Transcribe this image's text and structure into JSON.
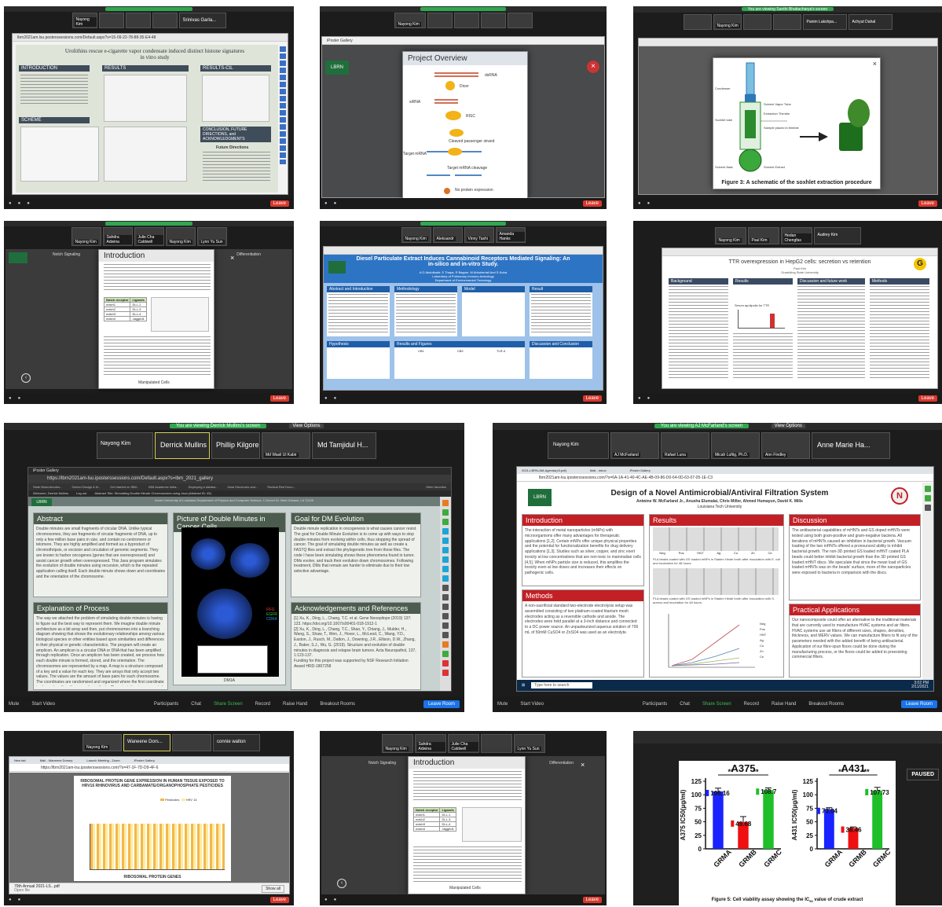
{
  "tiles": {
    "t1": {
      "participants": [
        "Nayong Kim",
        "Srinivas Garla..."
      ],
      "url": "lbrn2021am.lsu.posterssessions.com/Default.aspx?s=15-09-22-78-88-35-E4-48",
      "poster_title": "Urolithins rescue e-cigarette vapor condensate induced distinct histone signatures in vitro study",
      "sections": [
        "INTRODUCTION",
        "RESULTS",
        "RESULTS-CtL",
        "SCHEME",
        "CONCLUSION, FUTURE DIRECTIONS, and ACKNOWLEDGMENTS"
      ],
      "sub": "Future Directions"
    },
    "t2": {
      "participants": [
        "Nayong Kim"
      ],
      "tab": "iPoster Gallery",
      "modal_title": "Project Overview",
      "labels": [
        "dsRNA",
        "Dicer",
        "siRNA",
        "RISC",
        "Cleaved passenger strand",
        "Target mRNA",
        "Target mRNA cleavage",
        "No protein expression"
      ],
      "badge": "LBRN"
    },
    "t3": {
      "banner": "You are viewing Santhi Bhattacharya's screen",
      "participants": [
        "Nayong Kim",
        "Panim Lakshpa...",
        "Achyut Dahal"
      ],
      "caption": "Figure 3: A schematic of the soxhlet extraction procedure",
      "labels": [
        "Condenser",
        "Soxhlet tube",
        "Solvent flask",
        "Solvent Vapor Tube",
        "Extraction Thimble",
        "Sample placed in thimble",
        "Solvent Extract"
      ]
    },
    "t4": {
      "participants": [
        "Nayong Kim",
        "Sahdra Adwina",
        "Julie Cha Caldwell",
        "Nayong Kim",
        "Lynn Yu Sun"
      ],
      "modal_title": "Introduction",
      "left_label": "Notch Signaling",
      "right_label": "Differentiation",
      "table_headers": [
        "Notch receptor",
        "Ligands"
      ],
      "table_rows": [
        [
          "notch1",
          "DLL-1"
        ],
        [
          "notch2",
          "DLL-3"
        ],
        [
          "notch3",
          "DLL-4"
        ],
        [
          "notch4",
          "Jagged1"
        ],
        [
          "",
          "Jagged2"
        ]
      ],
      "bottom_label": "Manipulated Cells"
    },
    "t5": {
      "participants": [
        "Nayong Kim",
        "Aleksandr",
        "Vinny Tashi",
        "Amanda Hanks"
      ],
      "poster_title": "Diesel Particulate Extract Induces Cannabinoid Receptors Mediated Signaling: An in-silico and in-vitro Study.",
      "authors": "A G Abdulkadir, S Thapa, R Bagum, M Abbulmrtali And S Kutra",
      "lab": "Laboratory of Pulmonary Immuno-toxicology",
      "dept": "Department of Environmental Toxicology",
      "sections": [
        "Abstract and Introduction",
        "Methodology",
        "Model",
        "Result",
        "Hypothesis",
        "Results and Figures",
        "Discussion and Conclusion"
      ],
      "chart_labels": [
        "CB1",
        "CB2",
        "TLR-4"
      ]
    },
    "t6": {
      "participants": [
        "Nayong Kim",
        "Paul Kim",
        "Hedan Chengfas",
        "Audrey Kim"
      ],
      "poster_title": "TTR overexpression in HepG2 cells: secretion vs retention",
      "author": "Paul Kim",
      "school": "Grambling State University",
      "sections": [
        "Background",
        "Results",
        "Discussion and future work",
        "Methods"
      ],
      "chart_title": "Serum apolipolis for TTR"
    },
    "t7": {
      "banner": "You are viewing Derrick Mullins's screen",
      "view_options": "View Options",
      "participants": [
        "Nayong Kim",
        "Derrick Mullins",
        "Phillip Kilgore",
        "Md Wasil Ul Kabir",
        "Md Tamjidul H..."
      ],
      "tab": "iPoster Gallery",
      "url": "https://lbrn2021am-lsu.iposterssessions.com/Default.aspx?s=lbrn_2021_gallery",
      "bookmarks": [
        "Slate Biomolecules...",
        "Solved Design A M...",
        "Get started on IBM...",
        "IBM Academic Initia...",
        "Deploying a databa...",
        "Data Structures and...",
        "Radical Red Docu...",
        "Other favorites"
      ],
      "welcome": "Welcome, Derrick Mullins",
      "logout": "Log out",
      "abstract_title": "Abstract Title: Simulating Double Minute Chromosomes using Java (Abstract ID: 45)",
      "poster_header": "Xavier University of Louisiana Department of Physics and Computer Science, 1 Drexel Dr. New Orleans, LA 70125",
      "logo": "LBRN",
      "sections": {
        "abstract": "Abstract",
        "pic": "Picture of Double Minutes in Cancer Cells",
        "goal": "Goal for DM Evolution",
        "explain": "Explanation of Process",
        "ack": "Acknowledgements and References"
      },
      "abstract_text": "Double minutes are small fragments of circular DNA. Unlike typical chromosomes, they are fragments of circular fragments of DNA, up to only a few million base pairs in size, and contain no centromere or telomere. They are highly amplified and formed as a byproduct of chromothripsis, or excision and circulation of genomic segments. They are known to harbor oncogenes (genes that are overexpressed) and assist cancer growth when overexpressed. This Java program simulates the evolution of double minutes using recursion, which is the repeated application calling itself. Each double minute shows down and coordinates and the orientation of the chromosome.",
      "goal_text": "Double minute replication in oncogenesis is what causes cancer resist. The goal for Double Minute Evolution is to come up with ways to stop double minutes from evolving within cells, thus stopping the spread of cancer. The goal of simulating double minutes as well as create a FASTQ files and extract the phylogenetic tree from those files. The code I have been simulating shows these phenomena found in tumor. DMs evolve, and track their evolution down chromosomes. Following treatment, DMs that remain are harder to eliminate due to their low selective advantage.",
      "explain_text": "The way we attached the problem of simulating double minutes is having to figure out the best way to represent them. We imagine double minute architecture as a bit array and then, put chromosomes into a branching diagram showing that shows the evolutionary relationships among various biological species or other entities based upon similarities and differences in their physical or genetic characteristics. The program will create an amplicon. An amplicon is a circular DNA or DNA that has been amplified through replication. Once an amplicon has been created, we process how each double minute is formed, stored, and the orientation. The chromosomes are represented by a map. A map is a structure composed of a key and a value for each key. They are arrays that only accept two values. The values are the amount of base pairs for each chromosome. The coordinates are randomized and organized where the first coordinate is always less than the second coordinate. The orientation is represented by a positive or negative. There are equally recursive calls for it to replicate on its own. We start from a parent amplicon and then the recursive calls will replicate them by 2 each level.",
      "ack_text": "[1] Xu, K., Ding, L., Chang, T.C. et al. Gene Neoepitope (2019) 137: 123. https://doi.org/10.1007/s00401-018-1912-1\n[2] Xu, K., Ding, L., Chang, T.C., Shao, Y., Chiang, J., Mulder, H., Wang, S., Shaw, T., Wen, J., Hover, L., McLeod, C., Wang, Y.D., Easton, J., Rusch, M., Dalton, J., Downing, J.R., Ellison, D.W., Zhang, J., Baker, S.J., Wu, G. (2019). Structure and evolution of double minutes in diagnosis and relapse brain tumors. Acta Neuropathol, 137, 1:123-137.\nFunding for this project was supported by NSF Research Initiation Award HRD-1807258",
      "legend": [
        "RFG",
        "EGFR",
        "CDK4"
      ],
      "bottom_caption": "DM1A",
      "toolbar": [
        "Mute",
        "Start Video",
        "Participants",
        "Chat",
        "Share Screen",
        "Record",
        "Raise Hand",
        "Breakout Rooms"
      ],
      "leave": "Leave Room"
    },
    "t8": {
      "banner": "You are viewing AJ McFarland's screen",
      "view_options": "View Options",
      "participants": [
        "Nayong Kim",
        "AJ McFarland",
        "Rafael Luna",
        "Micah Luftig, Ph.D.",
        "Ann Findley",
        "Anne Marie Ha..."
      ],
      "tabs": [
        "2021-LBRN-AM-Agenda(v3.pdf)",
        "Mail - Inbox",
        "iPoster Gallery"
      ],
      "url": "lbrn2021am-lsu.iposterssessions.com/?s=6A-1A-41-40-4C-AE-4B-09-86-D0-64-0D-63-07-05-1E-C3",
      "poster_title": "Design of a Novel Antimicrobial/Antiviral Filtration System",
      "authors": "Antwine W. McFarland Jr., Anusha Elumalai, Chris Miller, Ahmed Humayun, David K. Mills",
      "school": "Louisiana Tech University",
      "logo": "LBRN",
      "sections": {
        "intro": "Introduction",
        "results": "Results",
        "discussion": "Discussion",
        "methods": "Methods",
        "practical": "Practical Applications"
      },
      "intro_text": "The interaction of metal nanoparticles (mNPs) with microorganisms offer many advantages for therapeutic applications [1,2]. Certain mNPs offer unique physical properties and the potential for functionalization benefits for drug delivery applications [1,3]. Studies such as silver, copper, and zinc exert toxicity at low concentrations that are non-toxic to mammalian cells [4,5]. When mNPs particle size is reduced, this amplifies the toxicity even at low doses and increases their effects on pathogenic cells.",
      "results_caption1": "PLA beads coated with GS loaded mNPs in Staden Hinde broth after inoculation with E. coli and incubation for 48 hours.",
      "results_caption2": "PLA beads coated with GS loaded mNPs in Staden Hinde broth after inoculation with S. aureus and incubation for 48 hours.",
      "discussion_text": "The antibacterial capabilities of mHNTs and GS doped mHNTs were tested using both gram-positive and gram-negative bacteria. All iterations of mHNTs caused an inhibition in bacterial growth. Vacuum loading of the two mHNTs offered a pronounced ability to inhibit bacterial growth. The non-3D printed GS loaded mHNT coated PLA beads could better inhibit bacterial growth than the 3D printed GS loaded mHNT discs. We speculate that since the mean load of GS loaded mHNTs was on the beads' surface, more of the nanoparticles were exposed to bacteria in comparison with the discs.",
      "practical_text": "Our nanocomposite could offer an alternative to the traditional materials that are currently used to manufacture HVAC systems and air filters. HVAC systems use air filters of different sizes, shapes, densities, thickness, and MERV values. We can manufacture filters to fit any of the parameters needed with the added benefit of being antibacterial. Application of our fibre-spun floors could be done during the manufacturing process, or the floors could be added to preexisting commercial filters.",
      "methods_text": "A non-sacrificial standard two-electrode electrolysis setup was assembled consisting of two platinum-coated titanium mesh electrodes acting as a reversible cathode and anode. The electrodes were held parallel at a 3-inch distance and connected to a DC power source. An unpasteurized aqueous solution of 700 mL of 50mM CuSO4 or ZnSO4 was used as an electrolyte.",
      "chart_legend": [
        "Neg",
        "Pos",
        "HNT",
        "Ag",
        "Cu",
        "Zn",
        "Ce"
      ],
      "bar_labels": [
        "Neg",
        "Pos",
        "HNT",
        "Ag",
        "Cu",
        "Zn",
        "Ce"
      ],
      "taskbar_search": "Type here to search",
      "time": "3:02 PM",
      "date": "2/11/2021",
      "toolbar": [
        "Mute",
        "Start Video",
        "Participants",
        "Chat",
        "Share Screen",
        "Record",
        "Raise Hand",
        "Breakout Rooms"
      ],
      "leave": "Leave Room"
    },
    "t9": {
      "participants": [
        "Nayong Kim",
        "Waneene Dors...",
        "connie walton"
      ],
      "tabs": [
        "New tab",
        "Mail - Waneene Dorsey",
        "Launch Meeting - Zoom",
        "iPoster Gallery"
      ],
      "url": "https://lbrn2021am-lsu.iposterssessions.com/?s=47-1F-7D-D9-4F-6",
      "chart_title": "RIBOSOMAL PROTEIN GENE EXPRESSION IN HUMAN TISSUE EXPOSED TO HRV16 RHINOVIRUS AND CARBAMATE/ORGANOPHOSPHATE PESTICIDES",
      "legend": [
        "Pesticides",
        "HRV 16"
      ],
      "xlabel": "RIBOSOMAL PROTEIN GENES",
      "download": "79th Annual 2021-LS...pdf",
      "open": "Open file",
      "show_all": "Show all"
    },
    "t10": {
      "participants": [
        "Nayong Kim",
        "Sahdra Adwina",
        "Julie Cha Caldwell",
        "Lynn Yu Sun"
      ],
      "modal_title": "Introduction",
      "left_label": "Notch Signaling",
      "right_label": "Differentiation",
      "table_headers": [
        "Notch receptor",
        "Ligands"
      ],
      "table_rows": [
        [
          "notch1",
          "DLL-1"
        ],
        [
          "notch2",
          "DLL-3"
        ],
        [
          "notch3",
          "DLL-4"
        ],
        [
          "notch4",
          "Jagged1"
        ],
        [
          "",
          "Jagged2"
        ]
      ],
      "bottom_label": "Manipulated Cells"
    },
    "t11": {
      "paused": "PAUSED",
      "caption_prefix": "Figure 5: Cell viability assay showing the IC",
      "caption_sub": "50",
      "caption_suffix": " value of crude extract"
    }
  },
  "chart_data": [
    {
      "type": "bar",
      "title": "A375",
      "ylabel": "A375 IC50(µg/ml)",
      "categories": [
        "GRMA",
        "GRMB",
        "GRMC"
      ],
      "values": [
        106.16,
        49.68,
        108.7
      ],
      "errors": [
        6,
        10,
        4
      ],
      "colors": [
        "#1a23ff",
        "#f01010",
        "#1fbf2a"
      ],
      "ylim": [
        0,
        125
      ],
      "yticks": [
        0,
        25,
        50,
        75,
        100,
        125
      ],
      "significance": [
        "**",
        "**"
      ]
    },
    {
      "type": "bar",
      "title": "A431",
      "ylabel": "A431 IC50(µg/ml)",
      "categories": [
        "GRMA",
        "GRMB",
        "GRMC"
      ],
      "values": [
        73.04,
        38.46,
        107.73
      ],
      "errors": [
        3,
        2,
        6
      ],
      "colors": [
        "#1a23ff",
        "#f01010",
        "#1fbf2a"
      ],
      "ylim": [
        0,
        125
      ],
      "yticks": [
        0,
        25,
        50,
        75,
        100,
        125
      ],
      "significance": [
        "**",
        "***"
      ]
    }
  ]
}
